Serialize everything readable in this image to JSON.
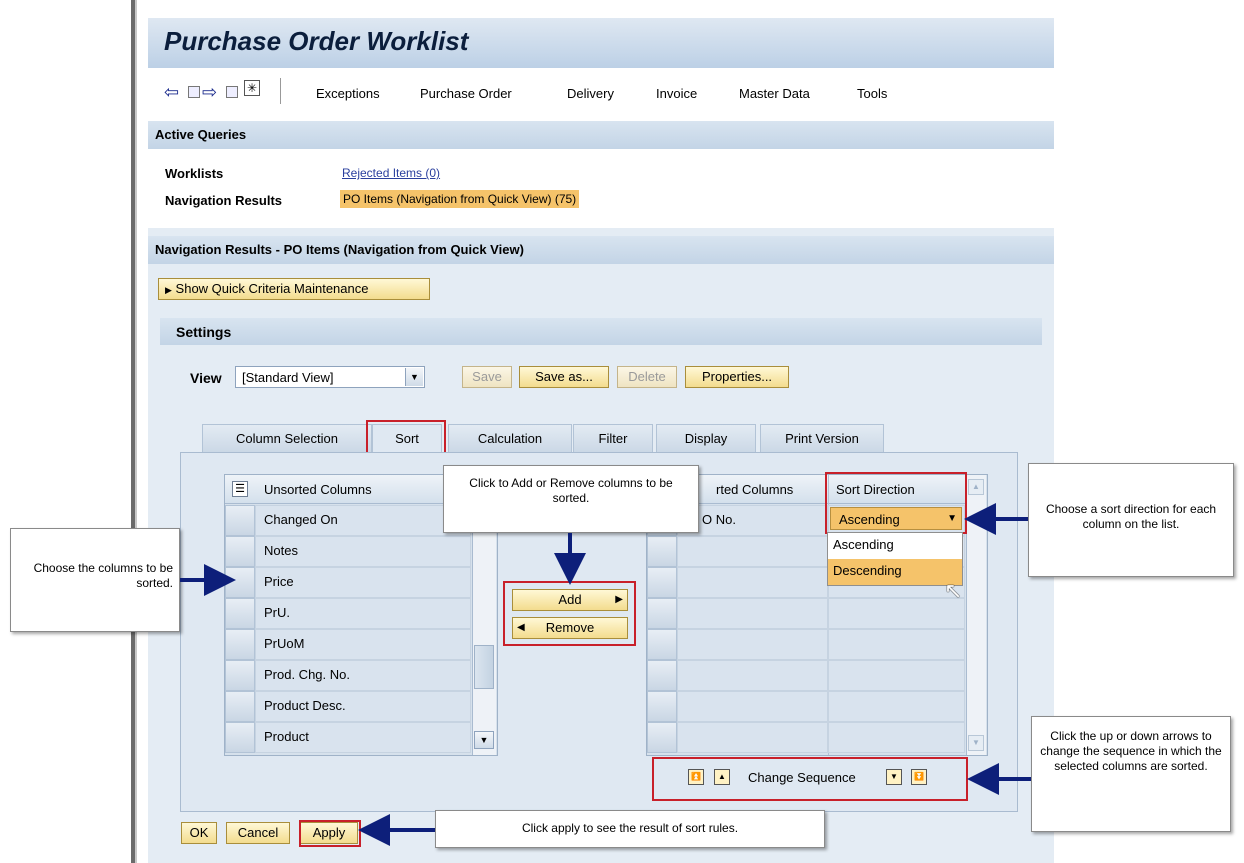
{
  "window": {
    "title": "Purchase Order Worklist"
  },
  "toolbar": {
    "menu": [
      "Exceptions",
      "Purchase Order",
      "Delivery",
      "Invoice",
      "Master Data",
      "Tools"
    ]
  },
  "active_queries": {
    "header": "Active Queries",
    "worklists_label": "Worklists",
    "worklists_link": "Rejected Items (0)",
    "nav_results_label": "Navigation Results",
    "nav_results_value": "PO Items (Navigation from Quick View) (75)"
  },
  "nav_results": {
    "header": "Navigation Results - PO Items (Navigation from Quick View)",
    "quick_criteria_button": "Show Quick Criteria Maintenance"
  },
  "settings": {
    "header": "Settings",
    "view_label": "View",
    "view_value": "[Standard View]",
    "buttons": {
      "save": "Save",
      "save_as": "Save as...",
      "delete": "Delete",
      "properties": "Properties..."
    },
    "tabs": [
      "Column Selection",
      "Sort",
      "Calculation",
      "Filter",
      "Display",
      "Print Version"
    ],
    "selected_tab": "Sort"
  },
  "unsorted": {
    "header": "Unsorted Columns",
    "rows": [
      "Changed On",
      "Notes",
      "Price",
      "PrU.",
      "PrUoM",
      "Prod. Chg. No.",
      "Product Desc.",
      "Product"
    ]
  },
  "sorted": {
    "header_partial": "rted Columns",
    "direction_header": "Sort Direction",
    "first_row_partial": "O No.",
    "direction_value": "Ascending",
    "dropdown_options": [
      "Ascending",
      "Descending"
    ],
    "highlighted_option": "Descending"
  },
  "mover": {
    "add": "Add",
    "remove": "Remove"
  },
  "sequence": {
    "label": "Change Sequence"
  },
  "footer": {
    "ok": "OK",
    "cancel": "Cancel",
    "apply": "Apply"
  },
  "callouts": {
    "add_remove": "Click to Add or Remove columns to be sorted.",
    "choose_columns": "Choose the columns to be sorted.",
    "sort_direction": "Choose a sort direction for each column on the list.",
    "sequence": "Click the up or down arrows to change the sequence in which the selected columns are sorted.",
    "apply": "Click apply to see the result of sort rules."
  },
  "colors": {
    "highlight": "#f5c36a",
    "annotation_red": "#c8202a",
    "arrow_navy": "#0d1f7a",
    "header_bar": "#c6d6e8",
    "link": "#2a3f9e"
  }
}
